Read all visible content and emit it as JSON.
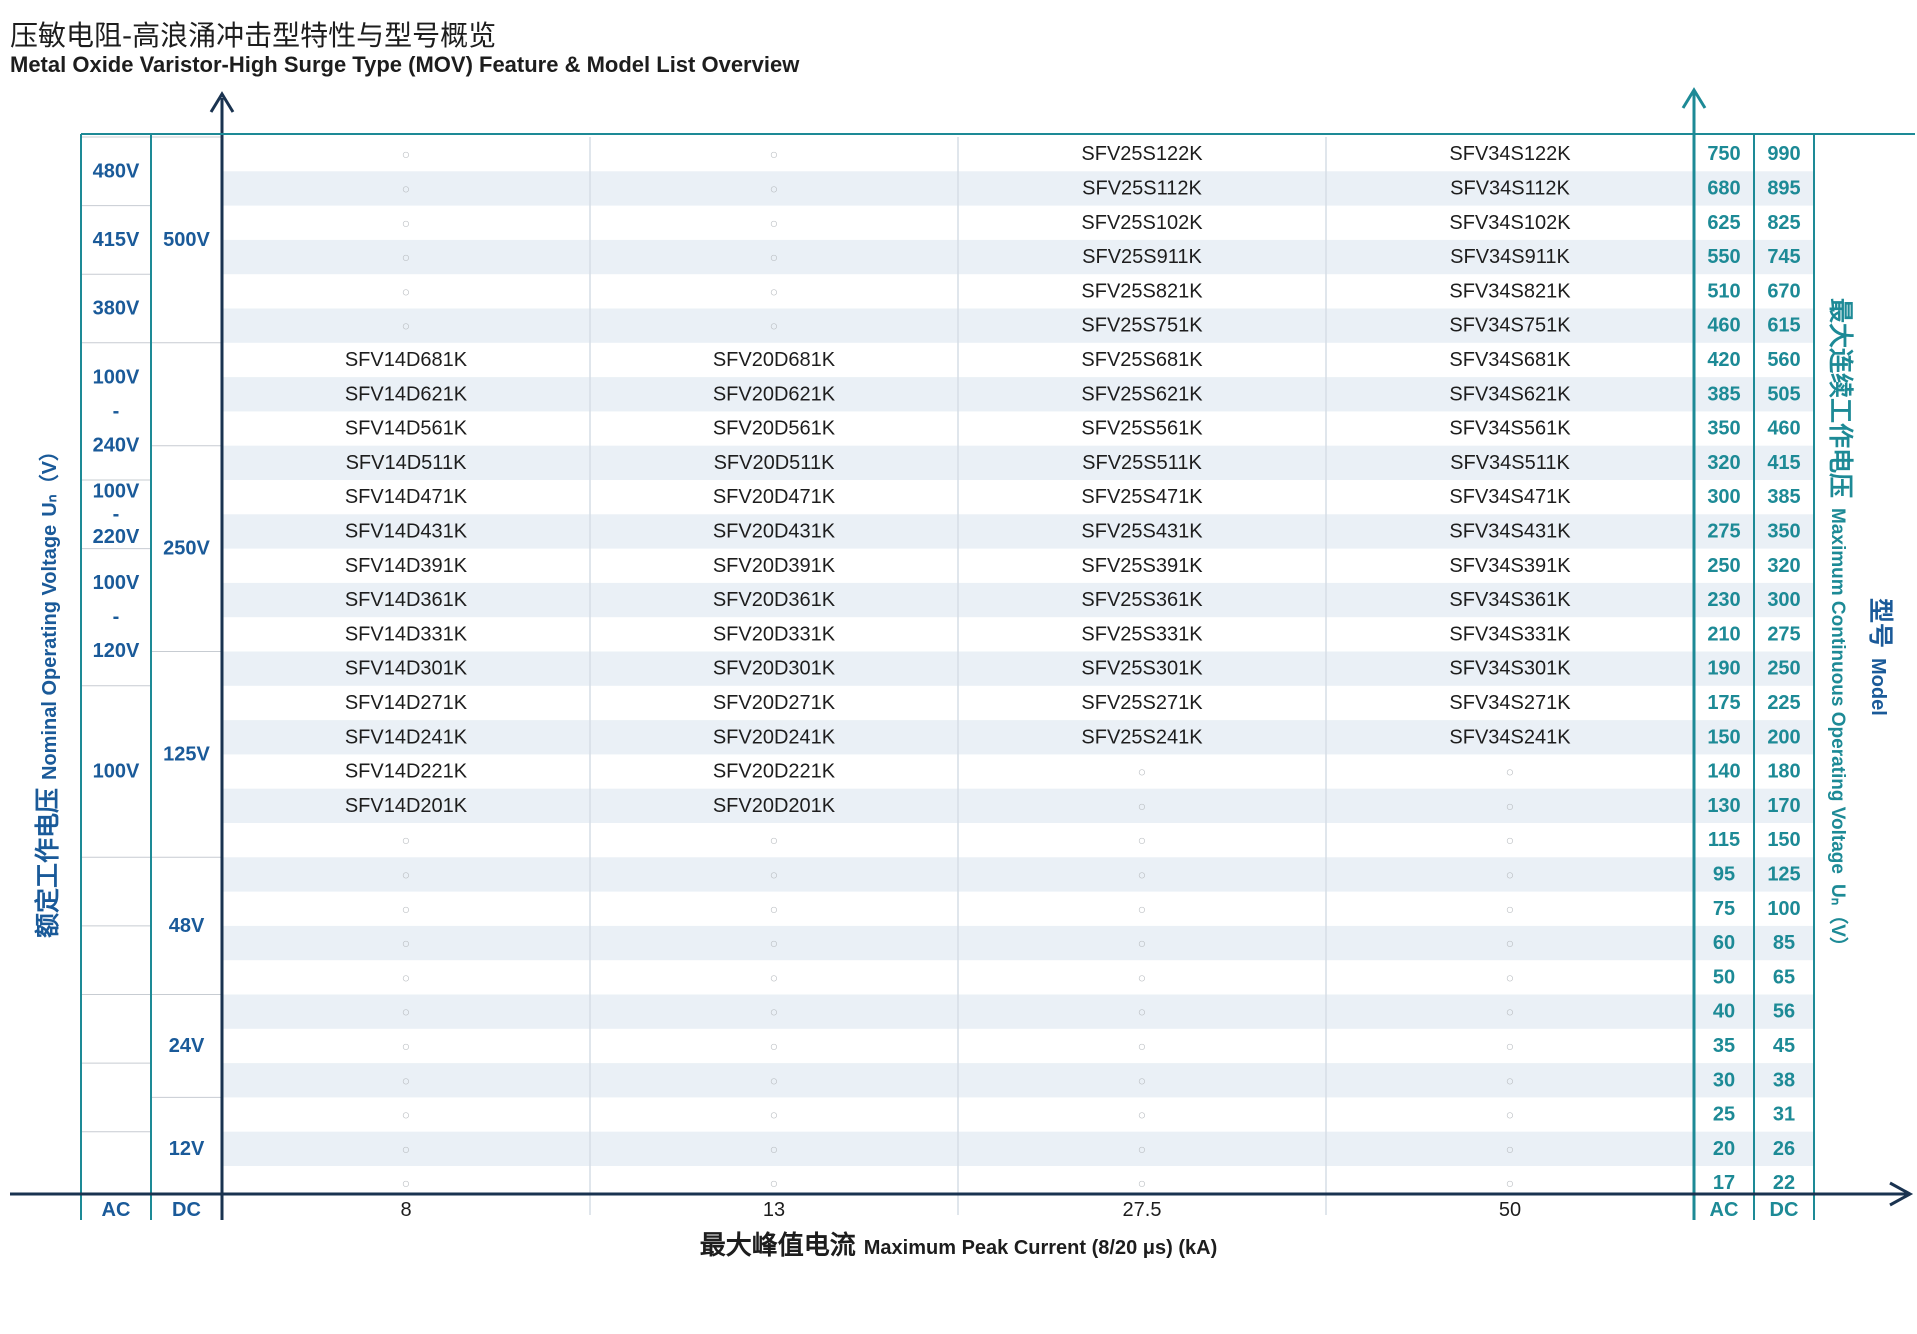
{
  "title_cn": "压敏电阻-高浪涌冲击型特性与型号概览",
  "title_en": "Metal Oxide Varistor-High Surge Type (MOV) Feature & Model List Overview",
  "x_axis": {
    "label_cn": "最大峰值电流",
    "label_en": "Maximum Peak Current (8/20 μs) (kA)",
    "categories": [
      "8",
      "13",
      "27.5",
      "50"
    ]
  },
  "left_axis": {
    "label_cn": "额定工作电压",
    "label_en": "Nominal Operating Voltage",
    "unit": "Uₙ（V）",
    "ac_header": "AC",
    "dc_header": "DC",
    "ac_groups": [
      {
        "row_start": 0,
        "row_end": 1,
        "lines": [
          "480V"
        ]
      },
      {
        "row_start": 2,
        "row_end": 3,
        "lines": [
          "415V"
        ]
      },
      {
        "row_start": 4,
        "row_end": 5,
        "lines": [
          "380V"
        ]
      },
      {
        "row_start": 6,
        "row_end": 9,
        "lines": [
          "100V",
          "-",
          "240V"
        ]
      },
      {
        "row_start": 10,
        "row_end": 11,
        "lines": [
          "100V",
          "-",
          "220V"
        ]
      },
      {
        "row_start": 12,
        "row_end": 15,
        "lines": [
          "100V",
          "-",
          "120V"
        ]
      },
      {
        "row_start": 16,
        "row_end": 20,
        "lines": [
          "100V"
        ]
      },
      {
        "row_start": 21,
        "row_end": 22,
        "lines": []
      },
      {
        "row_start": 23,
        "row_end": 24,
        "lines": []
      },
      {
        "row_start": 25,
        "row_end": 26,
        "lines": []
      },
      {
        "row_start": 27,
        "row_end": 28,
        "lines": []
      },
      {
        "row_start": 29,
        "row_end": 30,
        "lines": []
      }
    ],
    "dc_groups": [
      {
        "row_start": 0,
        "row_end": 5,
        "lines": [
          "500V"
        ]
      },
      {
        "row_start": 6,
        "row_end": 8,
        "lines": []
      },
      {
        "row_start": 9,
        "row_end": 14,
        "lines": [
          "250V"
        ]
      },
      {
        "row_start": 15,
        "row_end": 20,
        "lines": [
          "125V"
        ]
      },
      {
        "row_start": 21,
        "row_end": 24,
        "lines": [
          "48V"
        ]
      },
      {
        "row_start": 25,
        "row_end": 27,
        "lines": [
          "24V"
        ]
      },
      {
        "row_start": 28,
        "row_end": 30,
        "lines": [
          "12V"
        ]
      }
    ]
  },
  "right_axis": {
    "label_cn": "最大连续工作电压",
    "label_en": "Maximum Continuous Operating Voltage",
    "unit": "Uₙ（V）",
    "model_cn": "型号",
    "model_en": "Model",
    "ac_header": "AC",
    "dc_header": "DC"
  },
  "empty_marker": "○",
  "rows": [
    {
      "ac": "750",
      "dc": "990",
      "models": [
        "",
        "",
        "SFV25S122K",
        "SFV34S122K"
      ]
    },
    {
      "ac": "680",
      "dc": "895",
      "models": [
        "",
        "",
        "SFV25S112K",
        "SFV34S112K"
      ]
    },
    {
      "ac": "625",
      "dc": "825",
      "models": [
        "",
        "",
        "SFV25S102K",
        "SFV34S102K"
      ]
    },
    {
      "ac": "550",
      "dc": "745",
      "models": [
        "",
        "",
        "SFV25S911K",
        "SFV34S911K"
      ]
    },
    {
      "ac": "510",
      "dc": "670",
      "models": [
        "",
        "",
        "SFV25S821K",
        "SFV34S821K"
      ]
    },
    {
      "ac": "460",
      "dc": "615",
      "models": [
        "",
        "",
        "SFV25S751K",
        "SFV34S751K"
      ]
    },
    {
      "ac": "420",
      "dc": "560",
      "models": [
        "SFV14D681K",
        "SFV20D681K",
        "SFV25S681K",
        "SFV34S681K"
      ]
    },
    {
      "ac": "385",
      "dc": "505",
      "models": [
        "SFV14D621K",
        "SFV20D621K",
        "SFV25S621K",
        "SFV34S621K"
      ]
    },
    {
      "ac": "350",
      "dc": "460",
      "models": [
        "SFV14D561K",
        "SFV20D561K",
        "SFV25S561K",
        "SFV34S561K"
      ]
    },
    {
      "ac": "320",
      "dc": "415",
      "models": [
        "SFV14D511K",
        "SFV20D511K",
        "SFV25S511K",
        "SFV34S511K"
      ]
    },
    {
      "ac": "300",
      "dc": "385",
      "models": [
        "SFV14D471K",
        "SFV20D471K",
        "SFV25S471K",
        "SFV34S471K"
      ]
    },
    {
      "ac": "275",
      "dc": "350",
      "models": [
        "SFV14D431K",
        "SFV20D431K",
        "SFV25S431K",
        "SFV34S431K"
      ]
    },
    {
      "ac": "250",
      "dc": "320",
      "models": [
        "SFV14D391K",
        "SFV20D391K",
        "SFV25S391K",
        "SFV34S391K"
      ]
    },
    {
      "ac": "230",
      "dc": "300",
      "models": [
        "SFV14D361K",
        "SFV20D361K",
        "SFV25S361K",
        "SFV34S361K"
      ]
    },
    {
      "ac": "210",
      "dc": "275",
      "models": [
        "SFV14D331K",
        "SFV20D331K",
        "SFV25S331K",
        "SFV34S331K"
      ]
    },
    {
      "ac": "190",
      "dc": "250",
      "models": [
        "SFV14D301K",
        "SFV20D301K",
        "SFV25S301K",
        "SFV34S301K"
      ]
    },
    {
      "ac": "175",
      "dc": "225",
      "models": [
        "SFV14D271K",
        "SFV20D271K",
        "SFV25S271K",
        "SFV34S271K"
      ]
    },
    {
      "ac": "150",
      "dc": "200",
      "models": [
        "SFV14D241K",
        "SFV20D241K",
        "SFV25S241K",
        "SFV34S241K"
      ]
    },
    {
      "ac": "140",
      "dc": "180",
      "models": [
        "SFV14D221K",
        "SFV20D221K",
        "",
        ""
      ]
    },
    {
      "ac": "130",
      "dc": "170",
      "models": [
        "SFV14D201K",
        "SFV20D201K",
        "",
        ""
      ]
    },
    {
      "ac": "115",
      "dc": "150",
      "models": [
        "",
        "",
        "",
        ""
      ]
    },
    {
      "ac": "95",
      "dc": "125",
      "models": [
        "",
        "",
        "",
        ""
      ]
    },
    {
      "ac": "75",
      "dc": "100",
      "models": [
        "",
        "",
        "",
        ""
      ]
    },
    {
      "ac": "60",
      "dc": "85",
      "models": [
        "",
        "",
        "",
        ""
      ]
    },
    {
      "ac": "50",
      "dc": "65",
      "models": [
        "",
        "",
        "",
        ""
      ]
    },
    {
      "ac": "40",
      "dc": "56",
      "models": [
        "",
        "",
        "",
        ""
      ]
    },
    {
      "ac": "35",
      "dc": "45",
      "models": [
        "",
        "",
        "",
        ""
      ]
    },
    {
      "ac": "30",
      "dc": "38",
      "models": [
        "",
        "",
        "",
        ""
      ]
    },
    {
      "ac": "25",
      "dc": "31",
      "models": [
        "",
        "",
        "",
        ""
      ]
    },
    {
      "ac": "20",
      "dc": "26",
      "models": [
        "",
        "",
        "",
        ""
      ]
    },
    {
      "ac": "17",
      "dc": "22",
      "models": [
        "",
        "",
        "",
        ""
      ]
    }
  ],
  "colors": {
    "stripe": "#eaf0f6",
    "navy": "#1a3350",
    "blue_text": "#1a5a99",
    "teal": "#1d8a96",
    "divider": "#d6dde5",
    "empty_marker": "#b8bcc0"
  }
}
